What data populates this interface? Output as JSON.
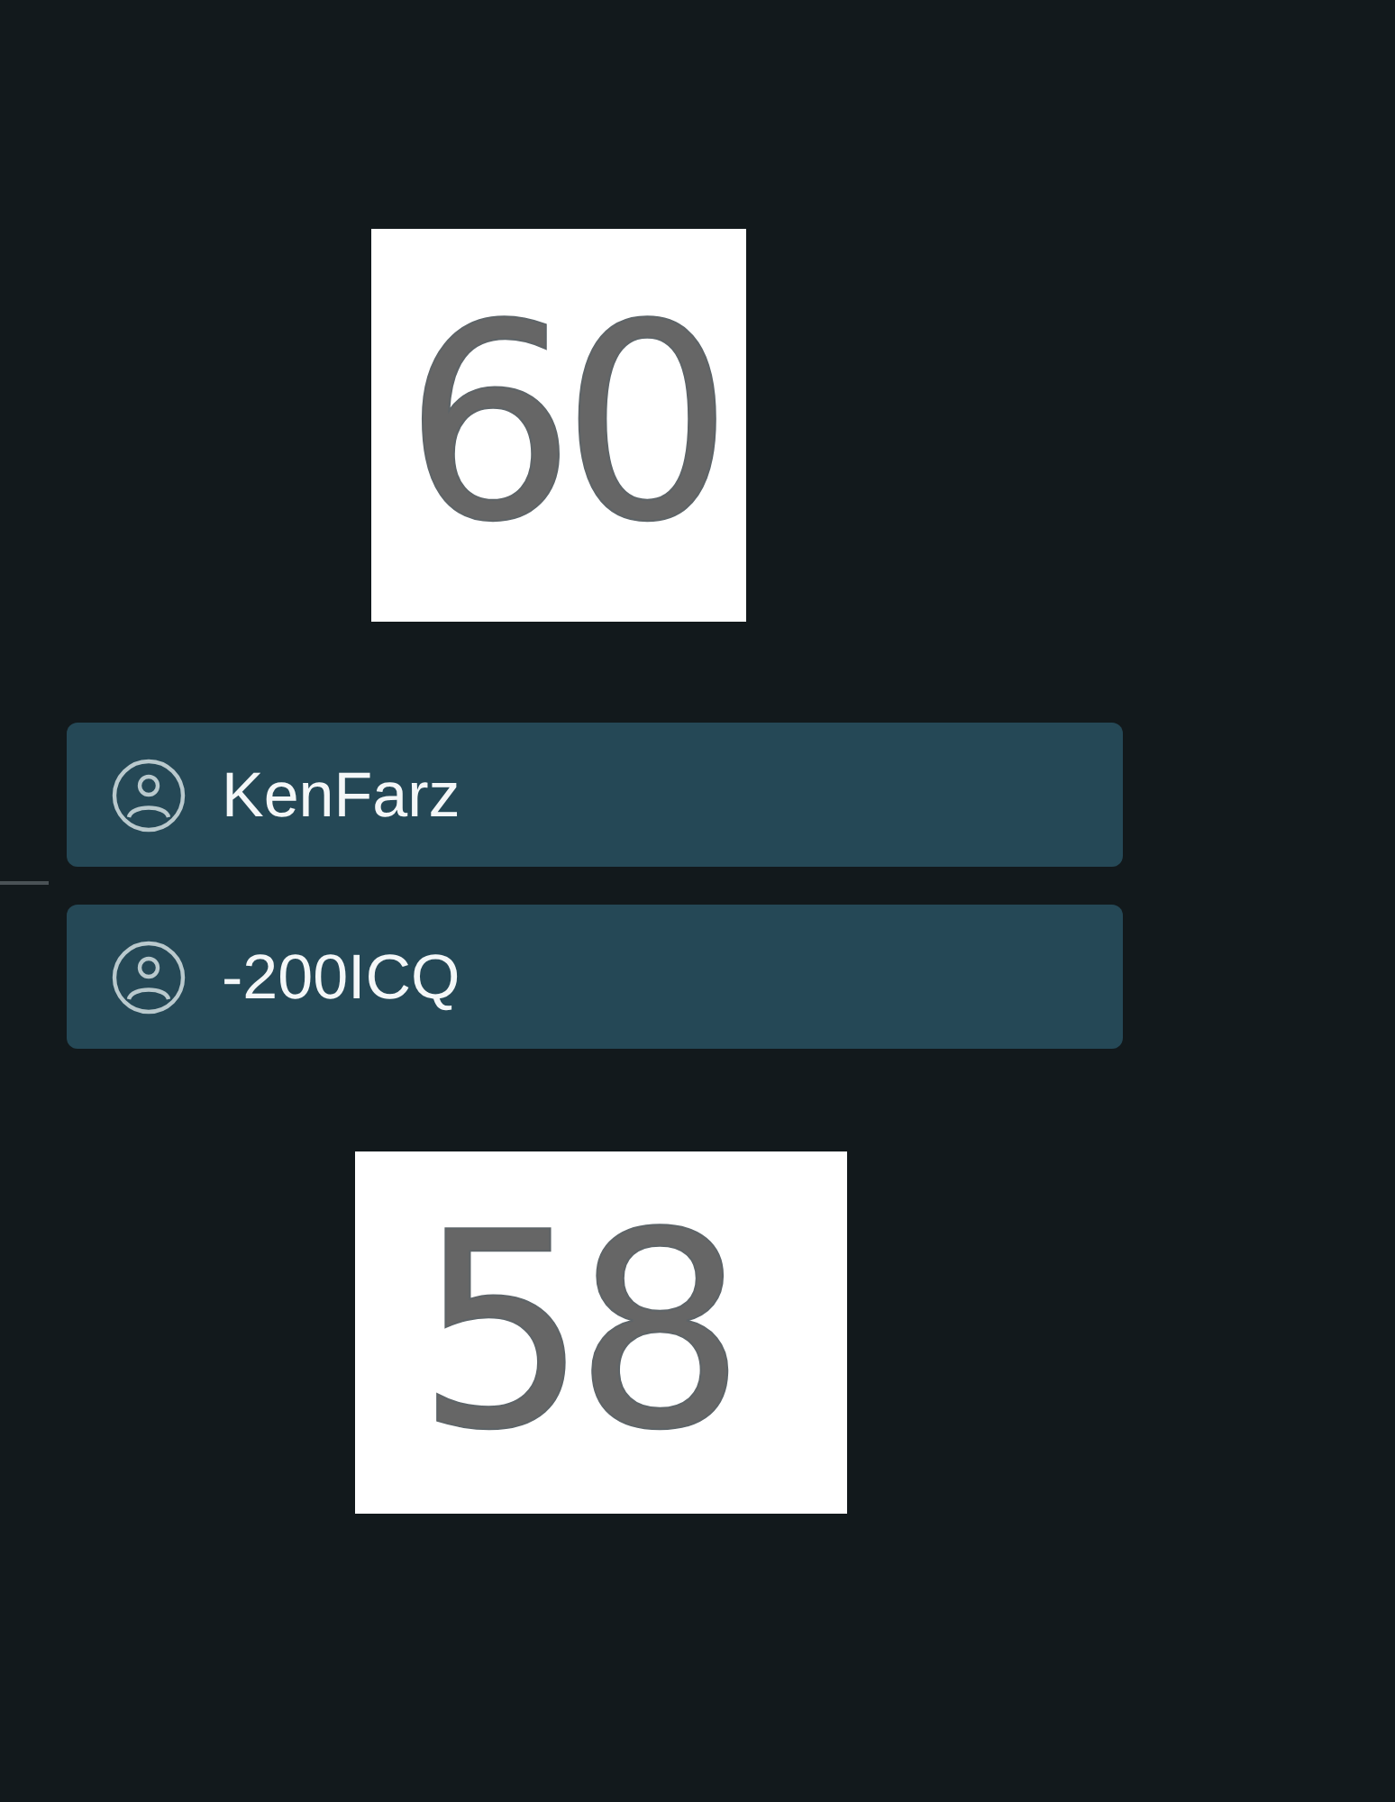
{
  "score_top": {
    "value": "60"
  },
  "players": [
    {
      "name": "KenFarz"
    },
    {
      "name": "-200ICQ"
    }
  ],
  "score_bottom": {
    "value": "58"
  }
}
